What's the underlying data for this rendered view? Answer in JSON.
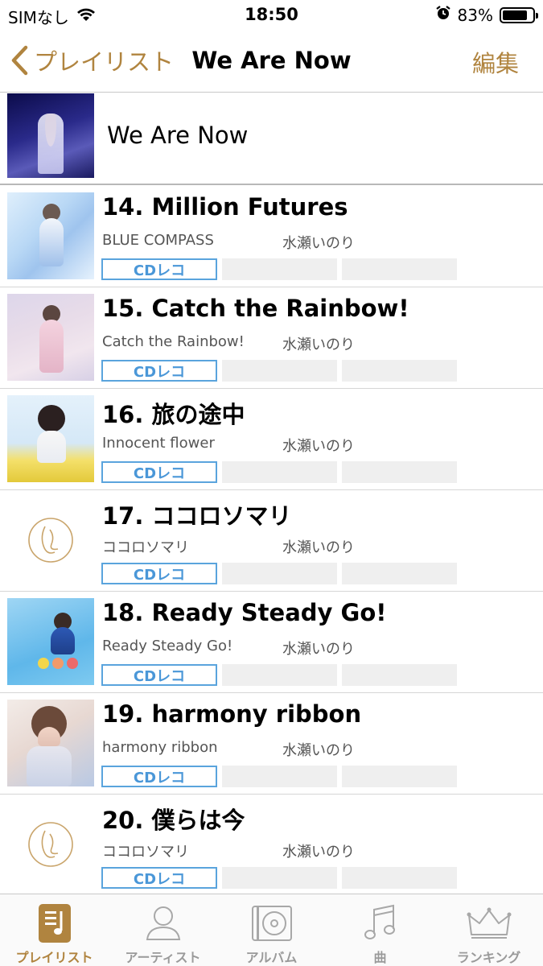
{
  "status_bar": {
    "carrier": "SIMなし",
    "time": "18:50",
    "battery": "83%",
    "battery_level": 0.83
  },
  "nav": {
    "back_label": "プレイリスト",
    "title": "We Are Now",
    "edit_label": "編集"
  },
  "playlist": {
    "title": "We Are Now"
  },
  "tracks": [
    {
      "title": "14. Million Futures",
      "album": "BLUE COMPASS",
      "artist": "水瀬いのり",
      "badge": "CDレコ"
    },
    {
      "title": "15. Catch the Rainbow!",
      "album": "Catch the Rainbow!",
      "artist": "水瀬いのり",
      "badge": "CDレコ"
    },
    {
      "title": "16. 旅の途中",
      "album": "Innocent flower",
      "artist": "水瀬いのり",
      "badge": "CDレコ"
    },
    {
      "title": "17. ココロソマリ",
      "album": "ココロソマリ",
      "artist": "水瀬いのり",
      "badge": "CDレコ"
    },
    {
      "title": "18. Ready Steady Go!",
      "album": "Ready Steady Go!",
      "artist": "水瀬いのり",
      "badge": "CDレコ"
    },
    {
      "title": "19. harmony ribbon",
      "album": "harmony ribbon",
      "artist": "水瀬いのり",
      "badge": "CDレコ"
    },
    {
      "title": "20. 僕らは今",
      "album": "ココロソマリ",
      "artist": "水瀬いのり",
      "badge": "CDレコ"
    }
  ],
  "tabbar": {
    "tabs": [
      {
        "label": "プレイリスト",
        "icon": "playlist-icon",
        "active": true
      },
      {
        "label": "アーティスト",
        "icon": "artist-icon",
        "active": false
      },
      {
        "label": "アルバム",
        "icon": "album-icon",
        "active": false
      },
      {
        "label": "曲",
        "icon": "music-note-icon",
        "active": false
      },
      {
        "label": "ランキング",
        "icon": "crown-icon",
        "active": false
      }
    ]
  },
  "colors": {
    "accent": "#b0843f",
    "badge_blue": "#4a97d8",
    "inactive_tab": "#9a9a9a"
  }
}
